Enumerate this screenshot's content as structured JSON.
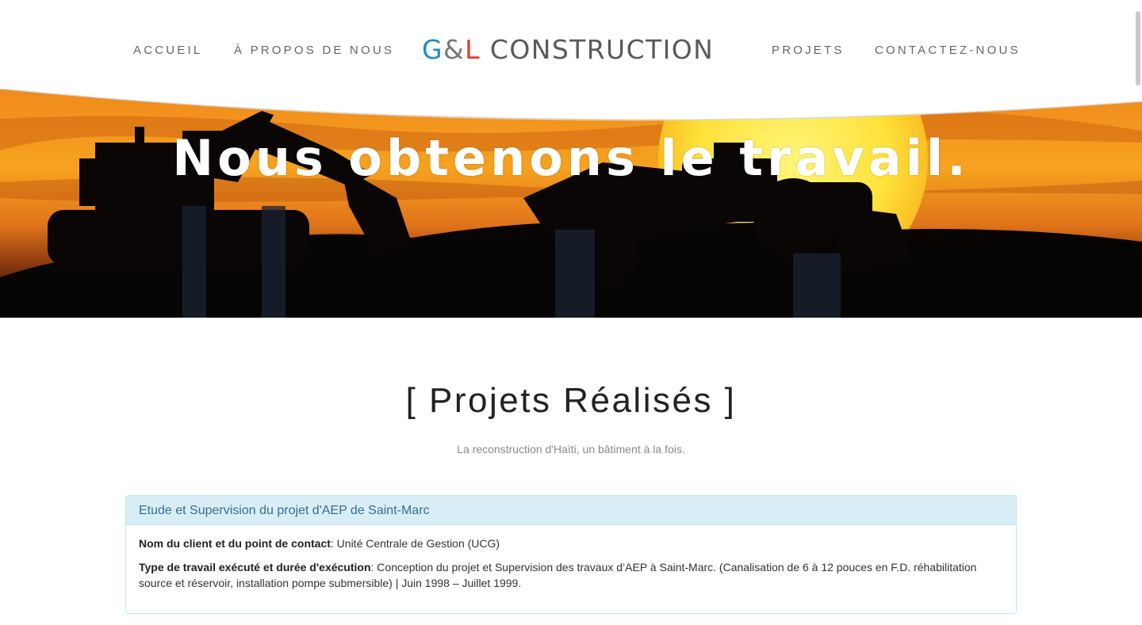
{
  "nav": {
    "items": [
      {
        "label": "ACCUEIL"
      },
      {
        "label": "À PROPOS DE NOUS"
      },
      {
        "label": "PROJETS"
      },
      {
        "label": "CONTACTEZ-NOUS"
      }
    ]
  },
  "logo": {
    "g": "G",
    "amp": "&",
    "l": "L",
    "rest": "CONSTRUCTION"
  },
  "hero": {
    "title": "Nous obtenons le travail."
  },
  "main": {
    "title": "[ Projets Réalisés ]",
    "subtitle": "La reconstruction d'Haïti, un bâtiment à la fois."
  },
  "projects": [
    {
      "title": "Etude et Supervision du projet d'AEP de Saint-Marc",
      "client_label": "Nom du client et du point de contact",
      "client_value": ": Unité Centrale de Gestion (UCG)",
      "work_label": "Type de travail exécuté et durée d'exécution",
      "work_value": ": Conception du projet et Supervision des travaux d’AEP à Saint-Marc. (Canalisation de 6 à 12 pouces en F.D. réhabilitation source et réservoir, installation pompe submersible) | Juin 1998 – Juillet 1999."
    }
  ],
  "colors": {
    "logo_g": "#1e88d6",
    "logo_l": "#e23a2e",
    "panel_heading_bg": "#d9edf7",
    "panel_heading_text": "#31708f",
    "panel_border": "#bce8f1"
  }
}
